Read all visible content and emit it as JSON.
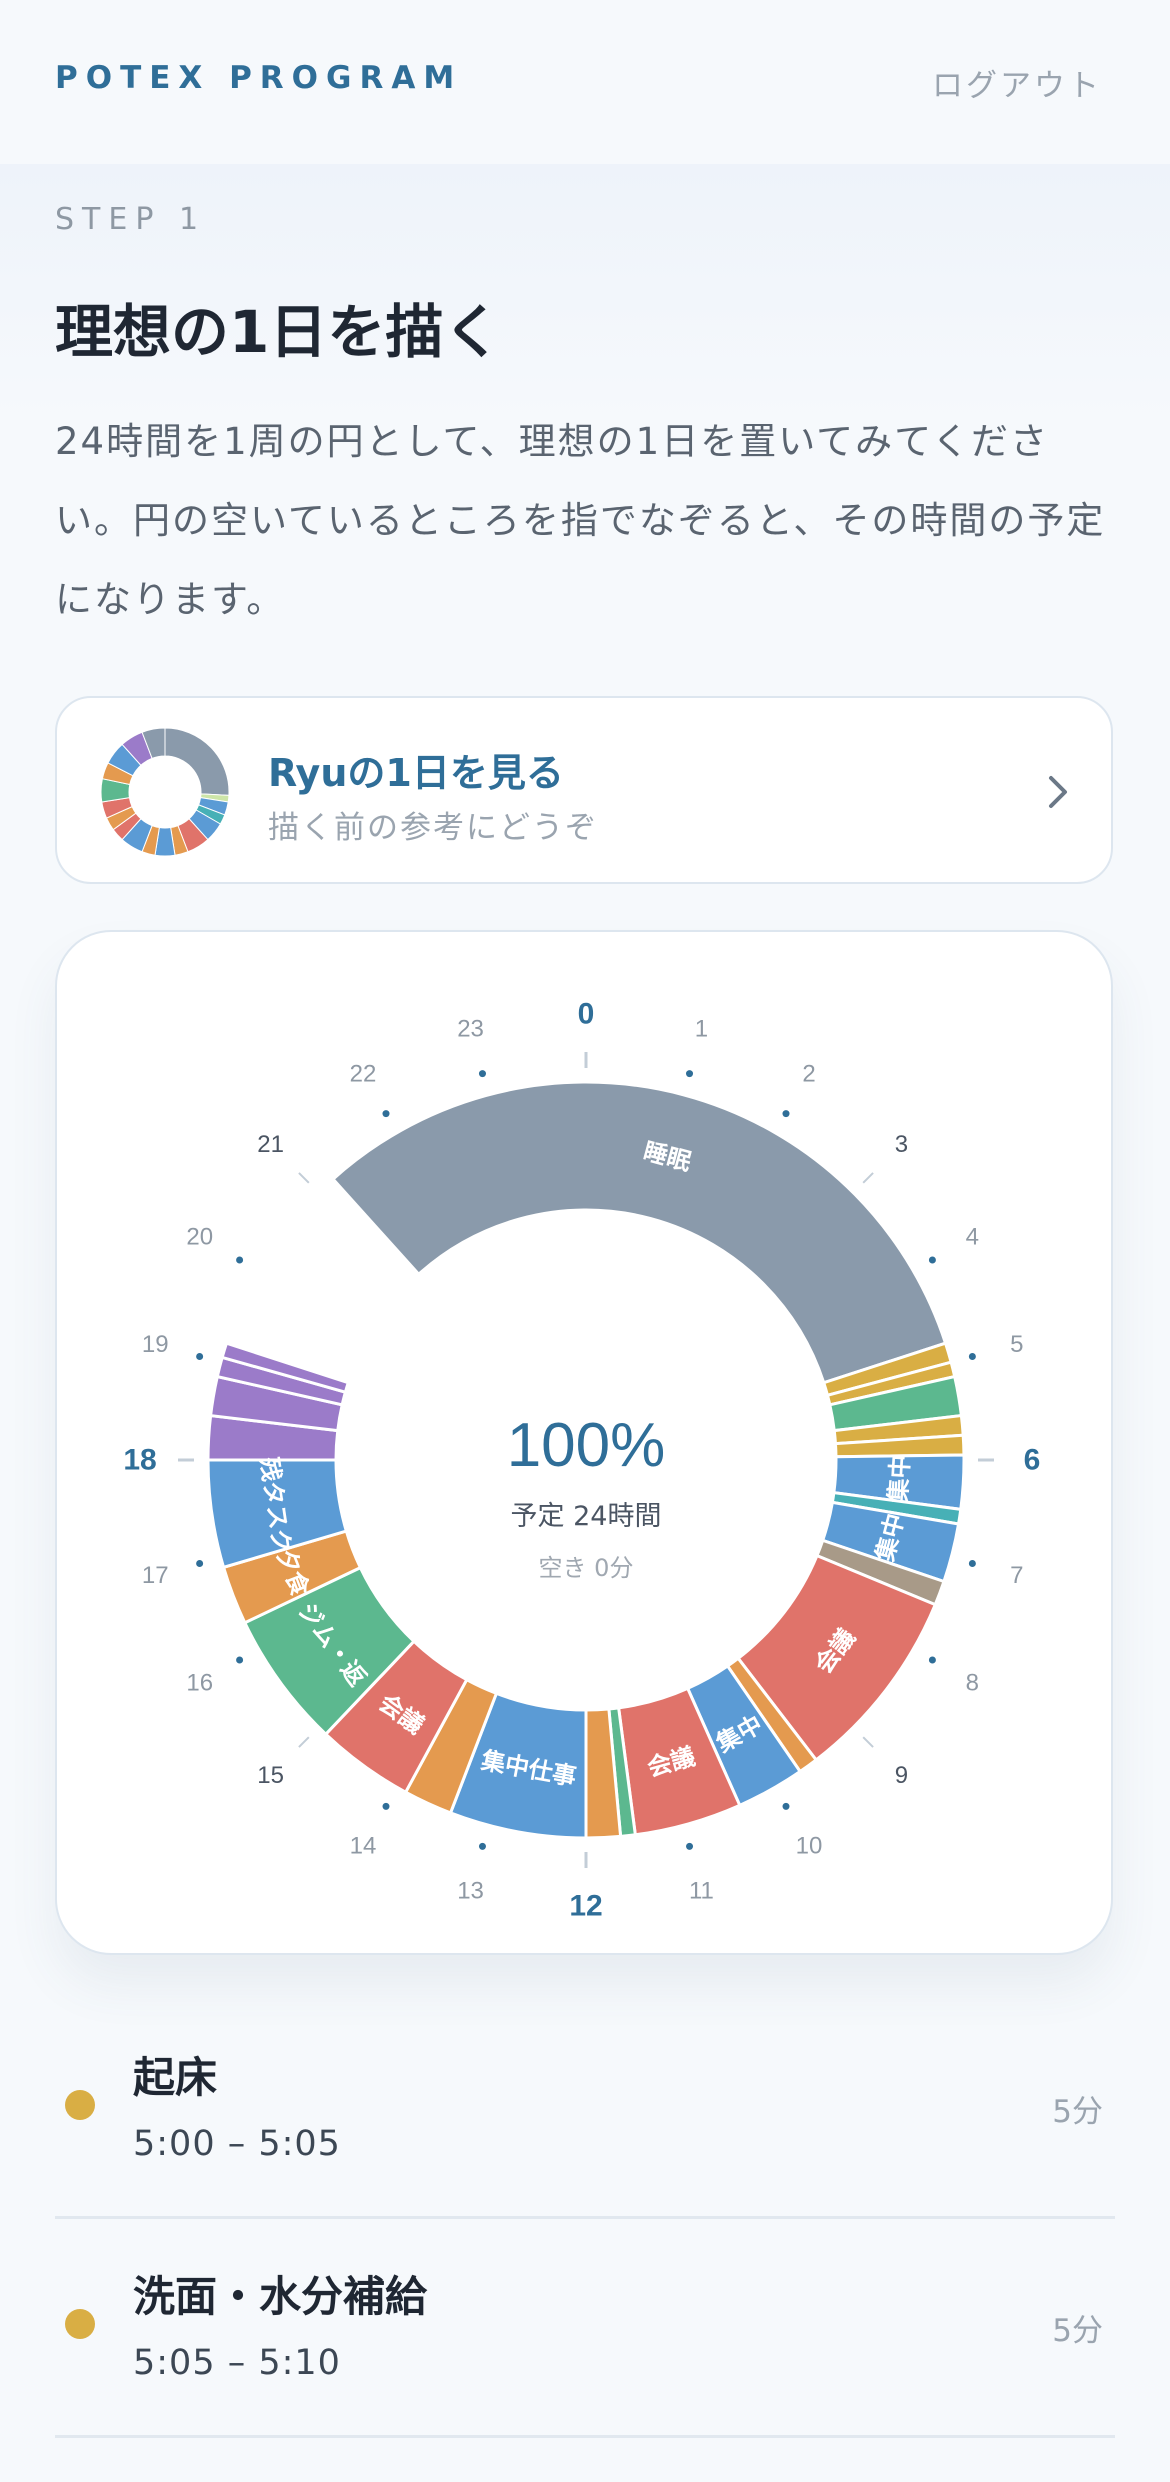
{
  "header": {
    "brand": "POTEX PROGRAM",
    "logout_label": "ログアウト"
  },
  "hero": {
    "step": "STEP 1",
    "title": "理想の1日を描く",
    "description": "24時間を1周の円として、理想の1日を置いてみてください。円の空いているところを指でなぞると、その時間の予定になります。"
  },
  "reference_card": {
    "title": "Ryuの1日を見る",
    "subtitle": "描く前の参考にどうぞ",
    "chevron_icon": "chevron-right-icon"
  },
  "clock": {
    "percent": "100%",
    "scheduled": "予定 24時間",
    "free": "空き 0分",
    "hour_labels": [
      "0",
      "1",
      "2",
      "3",
      "4",
      "5",
      "6",
      "7",
      "8",
      "9",
      "10",
      "11",
      "12",
      "13",
      "14",
      "15",
      "16",
      "17",
      "18",
      "19",
      "20",
      "21",
      "22",
      "23"
    ],
    "segments": [
      {
        "start": 21.2,
        "end": 28.8,
        "color": "#8a9aab",
        "label": "睡眠"
      },
      {
        "start": 28.8,
        "end": 29.0,
        "color": "#d9ae44",
        "label": ""
      },
      {
        "start": 29.0,
        "end": 29.15,
        "color": "#d9ae44",
        "label": ""
      },
      {
        "start": 29.15,
        "end": 29.55,
        "color": "#5cb88f",
        "label": ""
      },
      {
        "start": 29.55,
        "end": 29.75,
        "color": "#d9ae44",
        "label": ""
      },
      {
        "start": 29.75,
        "end": 29.95,
        "color": "#d9ae44",
        "label": ""
      },
      {
        "start": 29.95,
        "end": 30.5,
        "color": "#5b9bd5",
        "label": "集中"
      },
      {
        "start": 30.5,
        "end": 30.65,
        "color": "#47b0b6",
        "label": ""
      },
      {
        "start": 30.65,
        "end": 31.25,
        "color": "#5b9bd5",
        "label": "集中"
      },
      {
        "start": 31.25,
        "end": 31.5,
        "color": "#a89a88",
        "label": ""
      },
      {
        "start": 31.5,
        "end": 33.5,
        "color": "#e0736a",
        "label": "会議"
      },
      {
        "start": 33.5,
        "end": 33.7,
        "color": "#e49a4f",
        "label": ""
      },
      {
        "start": 33.7,
        "end": 34.4,
        "color": "#5b9bd5",
        "label": "集中"
      },
      {
        "start": 34.4,
        "end": 35.5,
        "color": "#e0736a",
        "label": "会議"
      },
      {
        "start": 35.5,
        "end": 35.65,
        "color": "#5cb88f",
        "label": ""
      },
      {
        "start": 35.65,
        "end": 36.0,
        "color": "#e49a4f",
        "label": ""
      },
      {
        "start": 36.0,
        "end": 37.4,
        "color": "#5b9bd5",
        "label": "集中仕事"
      },
      {
        "start": 37.4,
        "end": 37.9,
        "color": "#e49a4f",
        "label": ""
      },
      {
        "start": 37.9,
        "end": 38.9,
        "color": "#e0736a",
        "label": "会議"
      },
      {
        "start": 38.9,
        "end": 40.3,
        "color": "#5cb88f",
        "label": "ジム・返"
      },
      {
        "start": 40.3,
        "end": 40.9,
        "color": "#e49a4f",
        "label": "夕食"
      },
      {
        "start": 40.9,
        "end": 42.0,
        "color": "#5b9bd5",
        "label": "残タスク"
      },
      {
        "start": 42.0,
        "end": 42.45,
        "color": "#9b7bc9",
        "label": ""
      },
      {
        "start": 42.45,
        "end": 42.85,
        "color": "#9b7bc9",
        "label": ""
      },
      {
        "start": 42.85,
        "end": 43.05,
        "color": "#9b7bc9",
        "label": ""
      },
      {
        "start": 43.05,
        "end": 43.2,
        "color": "#9b7bc9",
        "label": ""
      }
    ]
  },
  "schedule": [
    {
      "name": "起床",
      "time": "5:00 – 5:05",
      "duration": "5分",
      "color": "#d9ae44"
    },
    {
      "name": "洗面・水分補給",
      "time": "5:05 – 5:10",
      "duration": "5分",
      "color": "#d9ae44"
    }
  ]
}
